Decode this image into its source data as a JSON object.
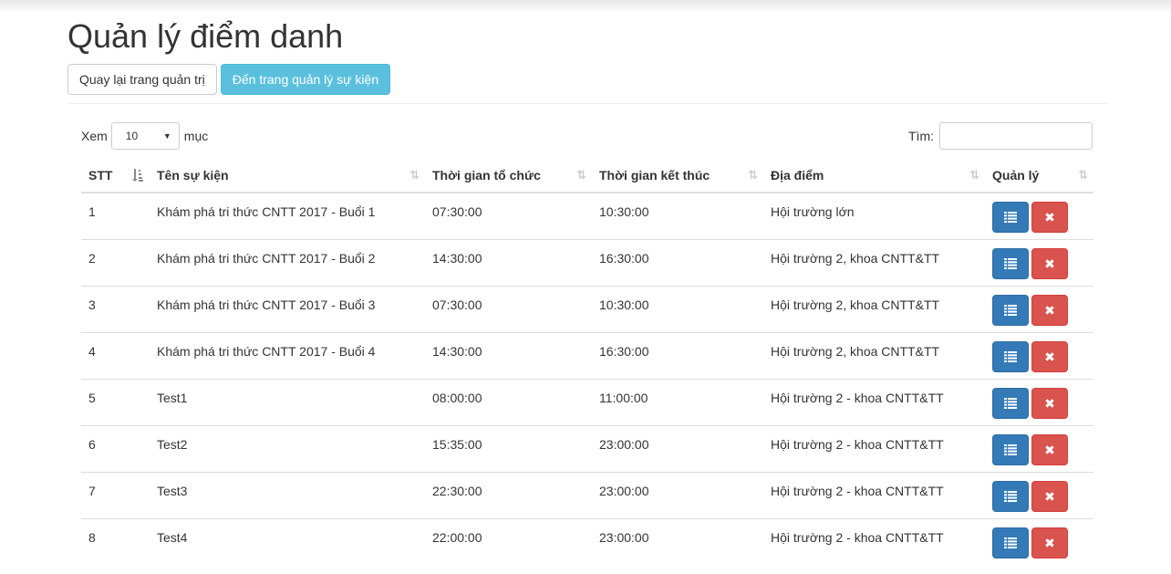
{
  "page": {
    "title": "Quản lý điểm danh",
    "back_button": "Quay lại trang quản trị",
    "events_button": "Đến trang quản lý sự kiện"
  },
  "table_controls": {
    "show_label": "Xem",
    "page_size": "10",
    "entries_label": "mục",
    "search_label": "Tìm:",
    "search_value": ""
  },
  "columns": [
    "STT",
    "Tên sự kiện",
    "Thời gian tổ chức",
    "Thời gian kết thúc",
    "Địa điểm",
    "Quản lý"
  ],
  "rows": [
    {
      "stt": "1",
      "name": "Khám phá tri thức CNTT 2017 - Buổi 1",
      "start": "07:30:00",
      "end": "10:30:00",
      "place": "Hội trường lớn"
    },
    {
      "stt": "2",
      "name": "Khám phá tri thức CNTT 2017 - Buổi 2",
      "start": "14:30:00",
      "end": "16:30:00",
      "place": "Hội trường 2, khoa CNTT&TT"
    },
    {
      "stt": "3",
      "name": "Khám phá tri thức CNTT 2017 - Buổi 3",
      "start": "07:30:00",
      "end": "10:30:00",
      "place": "Hội trường 2, khoa CNTT&TT"
    },
    {
      "stt": "4",
      "name": "Khám phá tri thức CNTT 2017 - Buổi 4",
      "start": "14:30:00",
      "end": "16:30:00",
      "place": "Hội trường 2, khoa CNTT&TT"
    },
    {
      "stt": "5",
      "name": "Test1",
      "start": "08:00:00",
      "end": "11:00:00",
      "place": "Hội trường 2 - khoa CNTT&TT"
    },
    {
      "stt": "6",
      "name": "Test2",
      "start": "15:35:00",
      "end": "23:00:00",
      "place": "Hội trường 2 - khoa CNTT&TT"
    },
    {
      "stt": "7",
      "name": "Test3",
      "start": "22:30:00",
      "end": "23:00:00",
      "place": "Hội trường 2 - khoa CNTT&TT"
    },
    {
      "stt": "8",
      "name": "Test4",
      "start": "22:00:00",
      "end": "23:00:00",
      "place": "Hội trường 2 - khoa CNTT&TT"
    }
  ],
  "icons": {
    "list_action": "list-icon",
    "delete_action": "remove-icon",
    "sort_active": "sort-amount-asc-icon",
    "sort_inactive": "sort-icon"
  },
  "colors": {
    "primary": "#337ab7",
    "danger": "#d9534f",
    "info": "#5bc0de"
  }
}
